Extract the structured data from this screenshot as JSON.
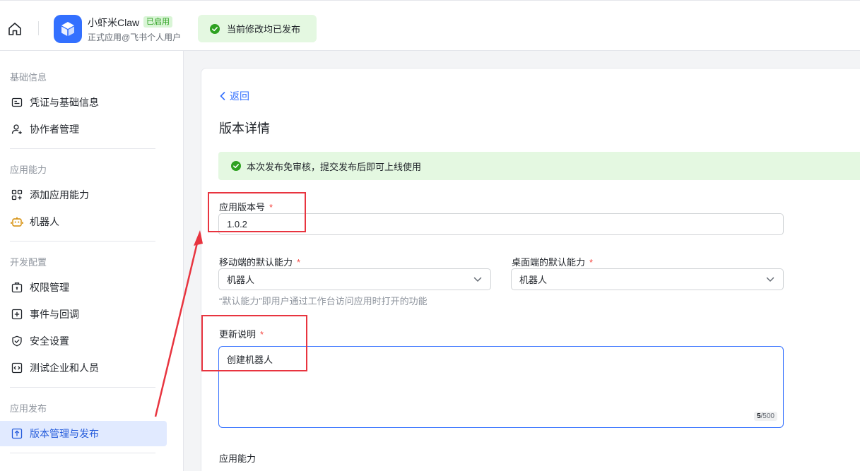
{
  "header": {
    "app_name": "小虾米Claw",
    "app_status_badge": "已启用",
    "app_subtitle": "正式应用@飞书个人用户",
    "publish_status": "当前修改均已发布",
    "colors": {
      "accent": "#3370ff",
      "success": "#2ea121",
      "success_bg": "#e4f8e1"
    }
  },
  "sidebar": {
    "groups": [
      {
        "title": "基础信息",
        "items": [
          {
            "label": "凭证与基础信息",
            "icon": "credential-icon"
          },
          {
            "label": "协作者管理",
            "icon": "user-add-icon"
          }
        ]
      },
      {
        "title": "应用能力",
        "items": [
          {
            "label": "添加应用能力",
            "icon": "apps-add-icon"
          },
          {
            "label": "机器人",
            "icon": "robot-icon"
          }
        ]
      },
      {
        "title": "开发配置",
        "items": [
          {
            "label": "权限管理",
            "icon": "permission-icon"
          },
          {
            "label": "事件与回调",
            "icon": "event-icon"
          },
          {
            "label": "安全设置",
            "icon": "shield-icon"
          },
          {
            "label": "测试企业和人员",
            "icon": "code-icon"
          }
        ]
      },
      {
        "title": "应用发布",
        "items": [
          {
            "label": "版本管理与发布",
            "icon": "upload-icon",
            "active": true
          }
        ]
      }
    ]
  },
  "main": {
    "back_label": "返回",
    "title": "版本详情",
    "notice": "本次发布免审核，提交发布后即可上线使用",
    "version": {
      "label": "应用版本号",
      "required_mark": "*",
      "value": "1.0.2"
    },
    "mobile_default": {
      "label": "移动端的默认能力",
      "required_mark": "*",
      "value": "机器人"
    },
    "desktop_default": {
      "label": "桌面端的默认能力",
      "required_mark": "*",
      "value": "机器人"
    },
    "default_hint": "“默认能力”即用户通过工作台访问应用时打开的功能",
    "release_notes": {
      "label": "更新说明",
      "required_mark": "*",
      "value": "创建机器人",
      "count": "5",
      "max": "/500"
    },
    "capabilities_label": "应用能力"
  }
}
